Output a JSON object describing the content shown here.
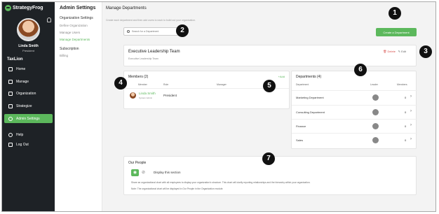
{
  "brand": "StrategyFrog",
  "user": {
    "name": "Linda Smith",
    "role": "President"
  },
  "org_name": "TaxLion",
  "nav": [
    {
      "label": "Home",
      "icon": "home-icon"
    },
    {
      "label": "Manage",
      "icon": "checkbox-icon"
    },
    {
      "label": "Organization",
      "icon": "org-icon"
    },
    {
      "label": "Strategize",
      "icon": "strategize-icon"
    },
    {
      "label": "Admin Settings",
      "icon": "gear-icon"
    },
    {
      "label": "Help",
      "icon": "help-icon"
    },
    {
      "label": "Log Out",
      "icon": "logout-icon"
    }
  ],
  "submenu": {
    "title": "Admin Settings",
    "section1": "Organization Settings",
    "items": [
      "Define Organization",
      "Manage Users",
      "Manage Departments"
    ],
    "section2": "Subscription",
    "section3": "Billing"
  },
  "main": {
    "title": "Manage Departments",
    "hint": "Create each department and then add users to each to build out your organization.",
    "search_placeholder": "Search for a Department",
    "create_button": "Create a Department"
  },
  "exec": {
    "title": "Executive Leadership Team",
    "subtitle": "Executive Leadership Team",
    "delete": "Delete",
    "edit": "Edit"
  },
  "members": {
    "title": "Members",
    "count": "(2)",
    "add": "Add",
    "columns": [
      "Member",
      "Role",
      "Manager"
    ],
    "rows": [
      {
        "name": "Linda Smith",
        "sub": "System Admin",
        "role": "President"
      }
    ]
  },
  "departments": {
    "title": "Departments",
    "count": "(4)",
    "columns": [
      "Department",
      "Leader",
      "Members"
    ],
    "rows": [
      {
        "name": "Marketing Department",
        "members": "0"
      },
      {
        "name": "Consulting Department",
        "members": "0"
      },
      {
        "name": "Finance",
        "members": "0"
      },
      {
        "name": "Sales",
        "members": "0"
      }
    ]
  },
  "people": {
    "title": "Our People",
    "display_label": "Display this section",
    "description": "Share an organizational chart with all employees to display your organization's structure. This chart will clarify reporting relationships and the hierarchy within your organization.",
    "note": "Note: The organizational chart will be displayed in Our People in the Organization module."
  },
  "callouts": [
    "1",
    "2",
    "3",
    "4",
    "5",
    "6",
    "7"
  ],
  "colors": {
    "accent": "#5cb85c",
    "sidebar": "#1e2226",
    "danger": "#d9534f"
  }
}
